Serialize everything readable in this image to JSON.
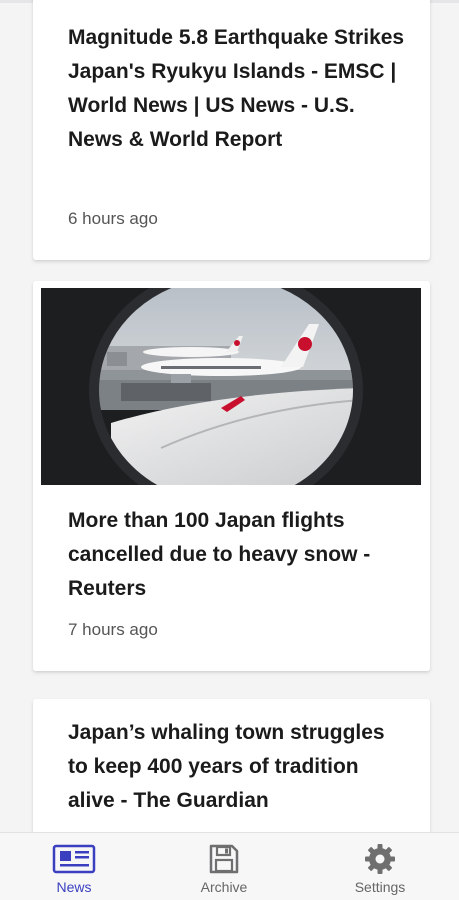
{
  "colors": {
    "accent": "#3a3fbf",
    "icon_inactive": "#6f6f6f",
    "headline_text": "#1b1b1b",
    "timestamp_text": "#555555"
  },
  "articles": [
    {
      "headline": "Magnitude 5.8 Earthquake Strikes Japan's Ryukyu Islands - EMSC | World News | US News - U.S. News & World Report",
      "time": "6 hours ago"
    },
    {
      "image": "airplane window view of JAL aircraft on snowy tarmac",
      "headline": "More than 100 Japan flights cancelled due to heavy snow - Reuters",
      "time": "7 hours ago"
    },
    {
      "headline": "Japan’s whaling town struggles to keep 400 years of tradition alive - The Guardian"
    }
  ],
  "nav": {
    "items": [
      {
        "label": "News",
        "icon": "newspaper-icon",
        "active": true
      },
      {
        "label": "Archive",
        "icon": "floppy-disk-icon",
        "active": false
      },
      {
        "label": "Settings",
        "icon": "gear-icon",
        "active": false
      }
    ]
  }
}
